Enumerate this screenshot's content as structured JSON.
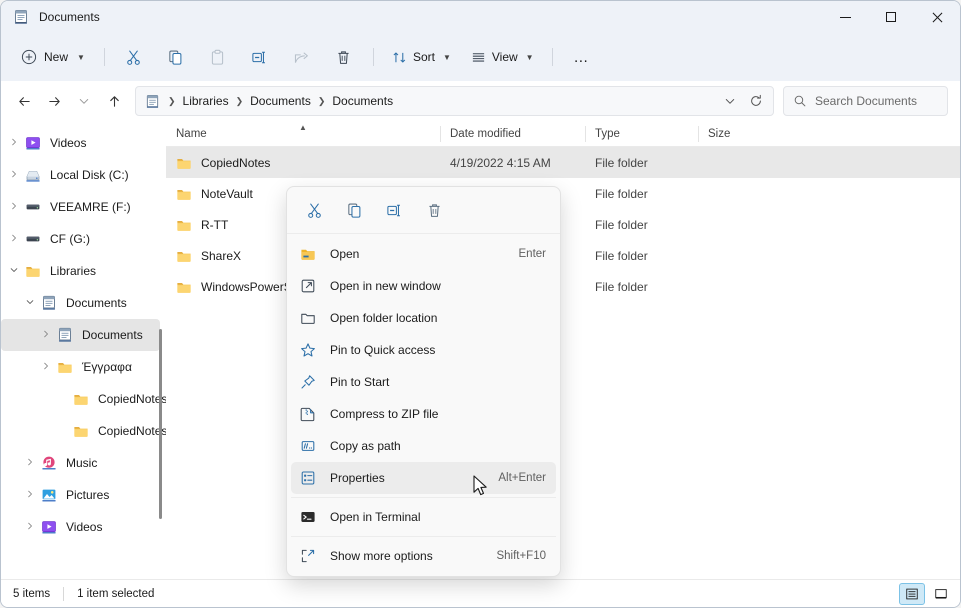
{
  "window": {
    "title": "Documents",
    "title_icon": "documents-library-icon",
    "minimize_label": "Minimize",
    "maximize_label": "Maximize",
    "close_label": "Close"
  },
  "toolbar": {
    "new_label": "New",
    "cut_label": "Cut",
    "copy_label": "Copy",
    "paste_label": "Paste",
    "rename_label": "Rename",
    "share_label": "Share",
    "delete_label": "Delete",
    "sort_label": "Sort",
    "view_label": "View",
    "more_label": "See more"
  },
  "address": {
    "back_label": "Back",
    "forward_label": "Forward",
    "recent_label": "Recent locations",
    "up_label": "Up to Libraries",
    "crumbs": [
      "Libraries",
      "Documents",
      "Documents"
    ],
    "dropdown_label": "Previous locations",
    "refresh_label": "Refresh",
    "search_placeholder": "Search Documents"
  },
  "sidebar": {
    "items": [
      {
        "label": "Videos",
        "icon": "videos-icon",
        "indent": 0,
        "twisty": "collapsed",
        "selected": false
      },
      {
        "label": "Local Disk (C:)",
        "icon": "harddisk-icon",
        "indent": 0,
        "twisty": "collapsed",
        "selected": false
      },
      {
        "label": "VEEAMRE (F:)",
        "icon": "drive-icon",
        "indent": 0,
        "twisty": "collapsed",
        "selected": false
      },
      {
        "label": "CF (G:)",
        "icon": "drive-icon",
        "indent": 0,
        "twisty": "collapsed",
        "selected": false
      },
      {
        "label": "Libraries",
        "icon": "folder-icon",
        "indent": 0,
        "twisty": "expanded",
        "selected": false
      },
      {
        "label": "Documents",
        "icon": "documents-library-icon",
        "indent": 1,
        "twisty": "expanded",
        "selected": false
      },
      {
        "label": "Documents",
        "icon": "documents-library-icon",
        "indent": 2,
        "twisty": "collapsed",
        "selected": true
      },
      {
        "label": "Έγγραφα",
        "icon": "folder-icon",
        "indent": 2,
        "twisty": "collapsed",
        "selected": false
      },
      {
        "label": "CopiedNotes",
        "icon": "folder-icon",
        "indent": 3,
        "twisty": "none",
        "selected": false
      },
      {
        "label": "CopiedNotes",
        "icon": "folder-icon",
        "indent": 3,
        "twisty": "none",
        "selected": false
      },
      {
        "label": "Music",
        "icon": "music-icon",
        "indent": 1,
        "twisty": "collapsed",
        "selected": false
      },
      {
        "label": "Pictures",
        "icon": "pictures-icon",
        "indent": 1,
        "twisty": "collapsed",
        "selected": false
      },
      {
        "label": "Videos",
        "icon": "videos-icon",
        "indent": 1,
        "twisty": "collapsed",
        "selected": false
      }
    ]
  },
  "filelist": {
    "columns": [
      {
        "label": "Name",
        "sorted": true,
        "sort_dir": "asc"
      },
      {
        "label": "Date modified",
        "sorted": false
      },
      {
        "label": "Type",
        "sorted": false
      },
      {
        "label": "Size",
        "sorted": false
      }
    ],
    "rows": [
      {
        "name": "CopiedNotes",
        "date": "4/19/2022 4:15 AM",
        "type": "File folder",
        "size": "",
        "selected": true
      },
      {
        "name": "NoteVault",
        "date": "",
        "type": "File folder",
        "size": "",
        "selected": false
      },
      {
        "name": "R-TT",
        "date": "",
        "type": "File folder",
        "size": "",
        "selected": false
      },
      {
        "name": "ShareX",
        "date": "",
        "type": "File folder",
        "size": "",
        "selected": false
      },
      {
        "name": "WindowsPowerS",
        "date": "",
        "type": "File folder",
        "size": "",
        "selected": false
      }
    ]
  },
  "contextmenu": {
    "quick_actions": [
      {
        "icon": "cut-icon",
        "label": "Cut"
      },
      {
        "icon": "copy-icon",
        "label": "Copy"
      },
      {
        "icon": "rename-icon",
        "label": "Rename"
      },
      {
        "icon": "delete-icon",
        "label": "Delete"
      }
    ],
    "items": [
      {
        "icon": "folder-open-icon",
        "label": "Open",
        "accel": "Enter",
        "hovered": false,
        "divider_after": false
      },
      {
        "icon": "open-new-window-icon",
        "label": "Open in new window",
        "accel": "",
        "hovered": false,
        "divider_after": false
      },
      {
        "icon": "folder-location-icon",
        "label": "Open folder location",
        "accel": "",
        "hovered": false,
        "divider_after": false
      },
      {
        "icon": "star-icon",
        "label": "Pin to Quick access",
        "accel": "",
        "hovered": false,
        "divider_after": false
      },
      {
        "icon": "pin-icon",
        "label": "Pin to Start",
        "accel": "",
        "hovered": false,
        "divider_after": false
      },
      {
        "icon": "zip-icon",
        "label": "Compress to ZIP file",
        "accel": "",
        "hovered": false,
        "divider_after": false
      },
      {
        "icon": "copy-path-icon",
        "label": "Copy as path",
        "accel": "",
        "hovered": false,
        "divider_after": false
      },
      {
        "icon": "properties-icon",
        "label": "Properties",
        "accel": "Alt+Enter",
        "hovered": true,
        "divider_after": true
      },
      {
        "icon": "terminal-icon",
        "label": "Open in Terminal",
        "accel": "",
        "hovered": false,
        "divider_after": true
      },
      {
        "icon": "more-options-icon",
        "label": "Show more options",
        "accel": "Shift+F10",
        "hovered": false,
        "divider_after": false
      }
    ]
  },
  "statusbar": {
    "item_count": "5 items",
    "selection": "1 item selected",
    "details_view_label": "Details view",
    "tiles_view_label": "Large icons view"
  },
  "colors": {
    "accent": "#0f6cbd",
    "chrome": "#eef2f8",
    "selected_row": "#e8e8e8",
    "folder": "#f7c755",
    "folder_dark": "#e2a93a"
  }
}
